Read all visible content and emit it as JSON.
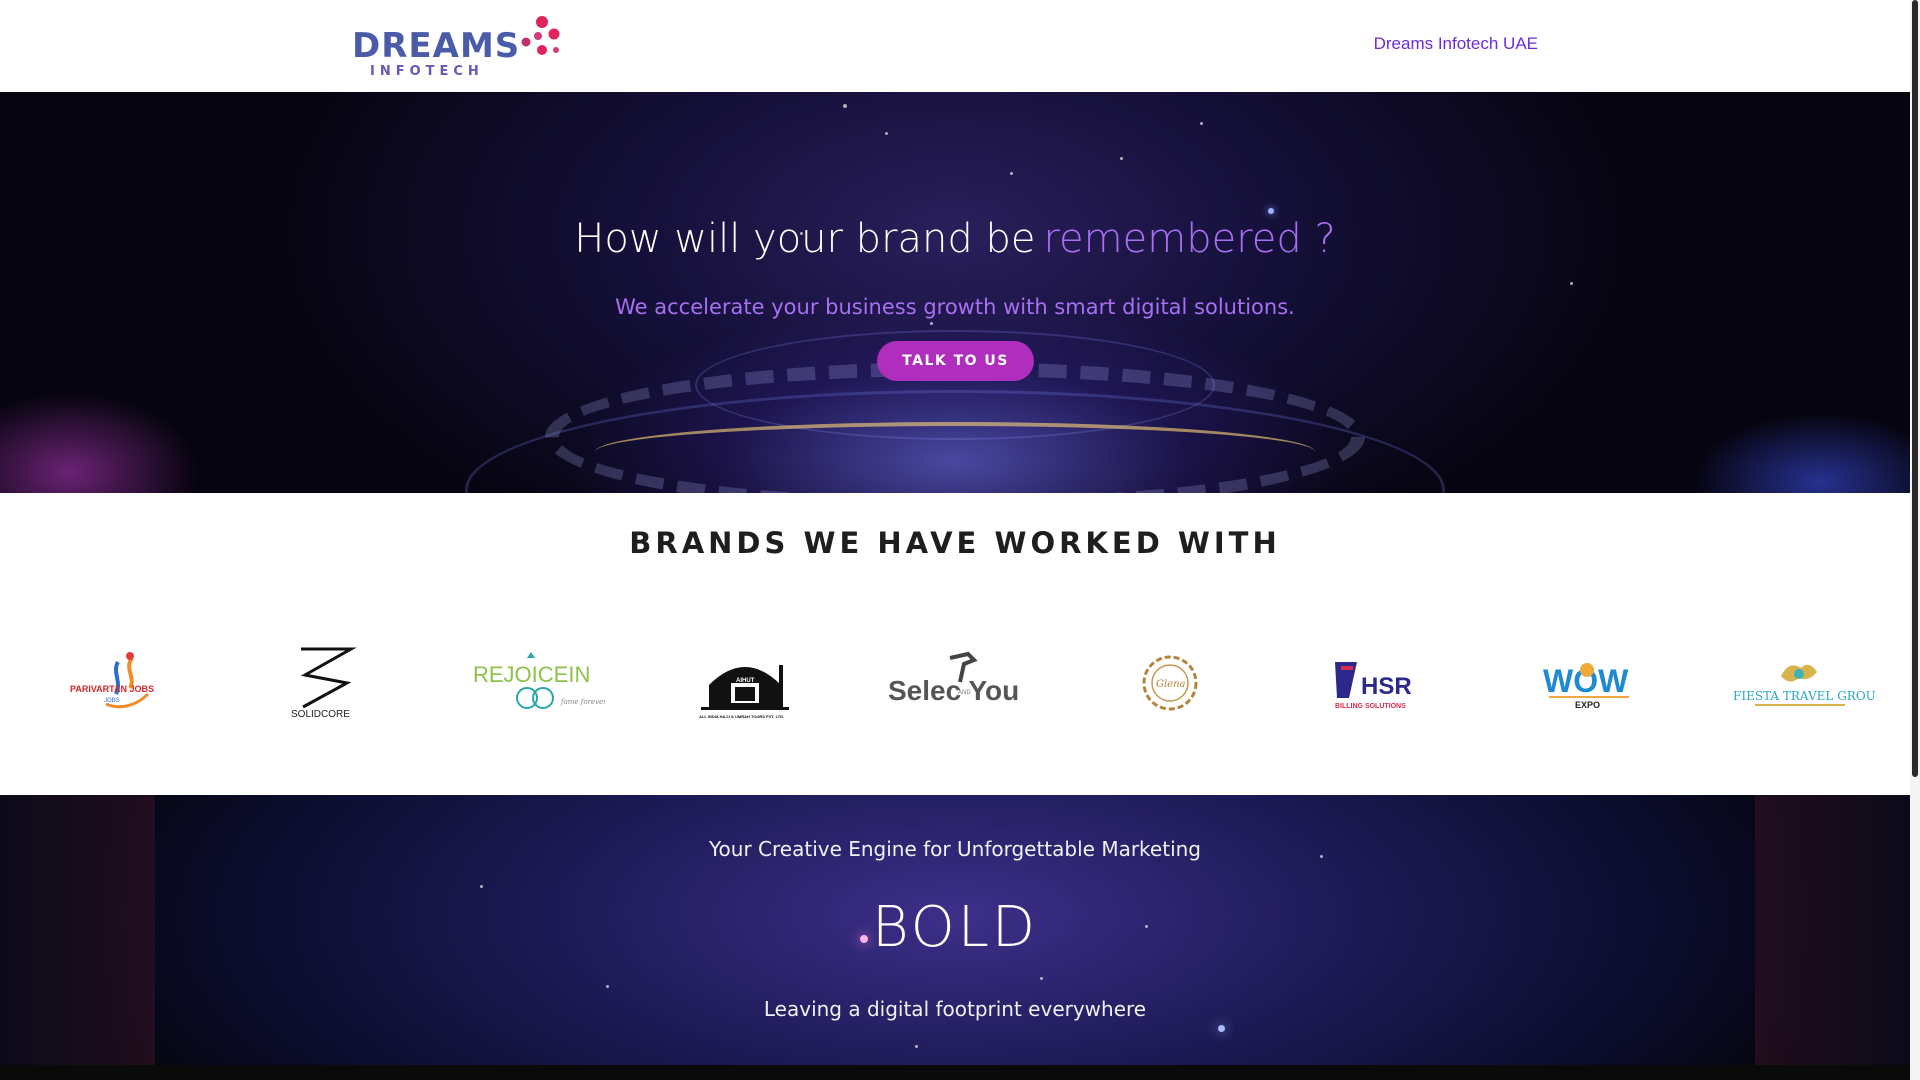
{
  "header": {
    "logo_text": "DREAMS",
    "logo_subtext": "INFOTECH",
    "nav_link": "Dreams Infotech UAE"
  },
  "hero": {
    "title": "How will your brand be",
    "title_accent": "remembered ?",
    "subtitle": "We accelerate your business growth with smart digital solutions.",
    "cta_label": "TALK TO US"
  },
  "brands": {
    "title": "BRANDS WE HAVE WORKED WITH",
    "logos": [
      {
        "name": "PARIVARTAN JOBS",
        "sub": "JOBS"
      },
      {
        "name": "SOLIDCORE"
      },
      {
        "name": "REJOICEIN",
        "sub": "fame forever"
      },
      {
        "name": "AIHUT",
        "sub": "ALL INDIA HAJJ & UMRAH TOURS PVT. LTD."
      },
      {
        "name": "Selec You",
        "sub": "AND"
      },
      {
        "name": "Glena"
      },
      {
        "name": "HSR",
        "sub": "BILLING SOLUTIONS"
      },
      {
        "name": "WOW",
        "sub": "EXPO"
      },
      {
        "name": "FIESTA TRAVEL GROUP"
      }
    ]
  },
  "banner": {
    "tagline": "Your Creative Engine for Unforgettable Marketing",
    "word": "BOLD",
    "footer": "Leaving a digital footprint everywhere"
  },
  "colors": {
    "accent_purple": "#a76ff2",
    "cta_magenta": "#b02ebd",
    "nav_purple": "#6c2bd9",
    "logo_blue": "#4a5ba8",
    "logo_dot_pink": "#e0245e"
  }
}
